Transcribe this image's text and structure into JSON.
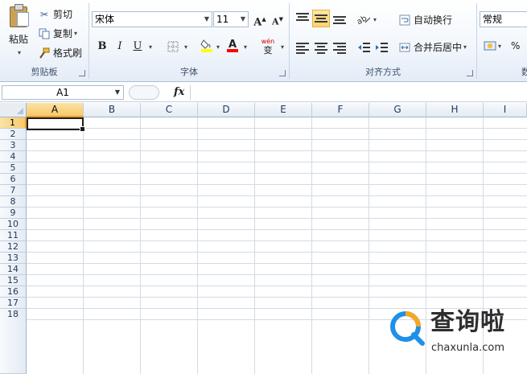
{
  "ribbon": {
    "clipboard": {
      "paste_label": "粘贴",
      "cut_label": "剪切",
      "copy_label": "复制",
      "format_painter_label": "格式刷",
      "group_label": "剪贴板"
    },
    "font": {
      "font_name": "宋体",
      "font_size": "11",
      "bold_label": "B",
      "italic_label": "I",
      "underline_label": "U",
      "wen_label": "wén",
      "phonetic_label": "变",
      "group_label": "字体",
      "fill_color": "#ffff00",
      "font_color": "#ff0000"
    },
    "alignment": {
      "wrap_text_label": "自动换行",
      "merge_center_label": "合并后居中",
      "group_label": "对齐方式"
    },
    "number": {
      "format_value": "常规",
      "percent_label": "%",
      "group_label": "数"
    }
  },
  "formula_bar": {
    "name_box_value": "A1",
    "fx_label": "fx",
    "formula_value": ""
  },
  "sheet": {
    "columns": [
      "A",
      "B",
      "C",
      "D",
      "E",
      "F",
      "G",
      "H",
      "I"
    ],
    "rows": [
      "1",
      "2",
      "3",
      "4",
      "5",
      "6",
      "7",
      "8",
      "9",
      "10",
      "11",
      "12",
      "13",
      "14",
      "15",
      "16",
      "17",
      "18"
    ],
    "active_cell": "A1"
  },
  "watermark": {
    "title": "查询啦",
    "url": "chaxunla.com",
    "accent_blue": "#1e90e8",
    "accent_orange": "#f5a623"
  }
}
